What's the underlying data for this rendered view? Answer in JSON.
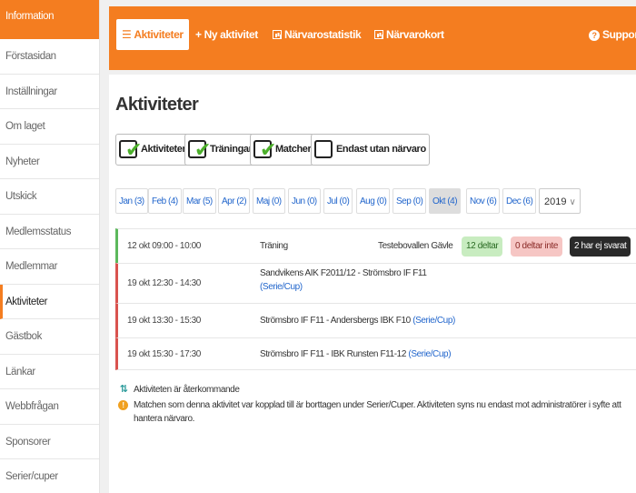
{
  "sidebar": {
    "header": "Information",
    "items": [
      "Förstasidan",
      "Inställningar",
      "Om laget",
      "Nyheter",
      "Utskick",
      "Medlemsstatus",
      "Medlemmar",
      "Aktiviteter",
      "Gästbok",
      "Länkar",
      "Webbfrågan",
      "Sponsorer",
      "Serier/cuper"
    ],
    "active_index": 7
  },
  "topnav": {
    "activities": "Aktiviteter",
    "new_activity": "Ny aktivitet",
    "attendance_stats": "Närvarostatistik",
    "attendance_card": "Närvarokort",
    "support": "Support"
  },
  "page": {
    "title": "Aktiviteter"
  },
  "filters": {
    "activities": "Aktiviteter",
    "trainings": "Träningar",
    "matches": "Matcher",
    "no_attendance_only": "Endast utan närvaro",
    "checked": [
      true,
      true,
      true,
      false
    ]
  },
  "months": [
    "Jan (3)",
    "Feb (4)",
    "Mar (5)",
    "Apr (2)",
    "Maj (0)",
    "Jun (0)",
    "Jul (0)",
    "Aug (0)",
    "Sep (0)",
    "Okt (4)",
    "Nov (6)",
    "Dec (6)"
  ],
  "current_month_index": 9,
  "year": "2019",
  "activities": [
    {
      "time": "12 okt 09:00 - 10:00",
      "title": "Träning",
      "location": "Testebovallen Gävle",
      "participating": "12 deltar",
      "not_participating": "0 deltar inte",
      "not_answered": "2 har ej svarat"
    },
    {
      "time": "19 okt 12:30 - 14:30",
      "title": "Sandvikens AIK F2011/12 - Strömsbro IF F11",
      "link": "(Serie/Cup)"
    },
    {
      "time": "19 okt 13:30 - 15:30",
      "title": "Strömsbro IF F11 - Andersbergs IBK F10",
      "link": "(Serie/Cup)"
    },
    {
      "time": "19 okt 15:30 - 17:30",
      "title": "Strömsbro IF F11 - IBK Runsten F11-12",
      "link": "(Serie/Cup)"
    }
  ],
  "legend": {
    "recurring": "Aktiviteten är återkommande",
    "notice": "Matchen som denna aktivitet var kopplad till är borttagen under Serier/Cuper. Aktiviteten syns nu endast mot administratörer i syfte att hantera närvaro."
  },
  "colors": {
    "accent": "#f47d20",
    "link": "#2266cc",
    "training_bar": "#5cb85c",
    "match_bar": "#d9534f"
  }
}
